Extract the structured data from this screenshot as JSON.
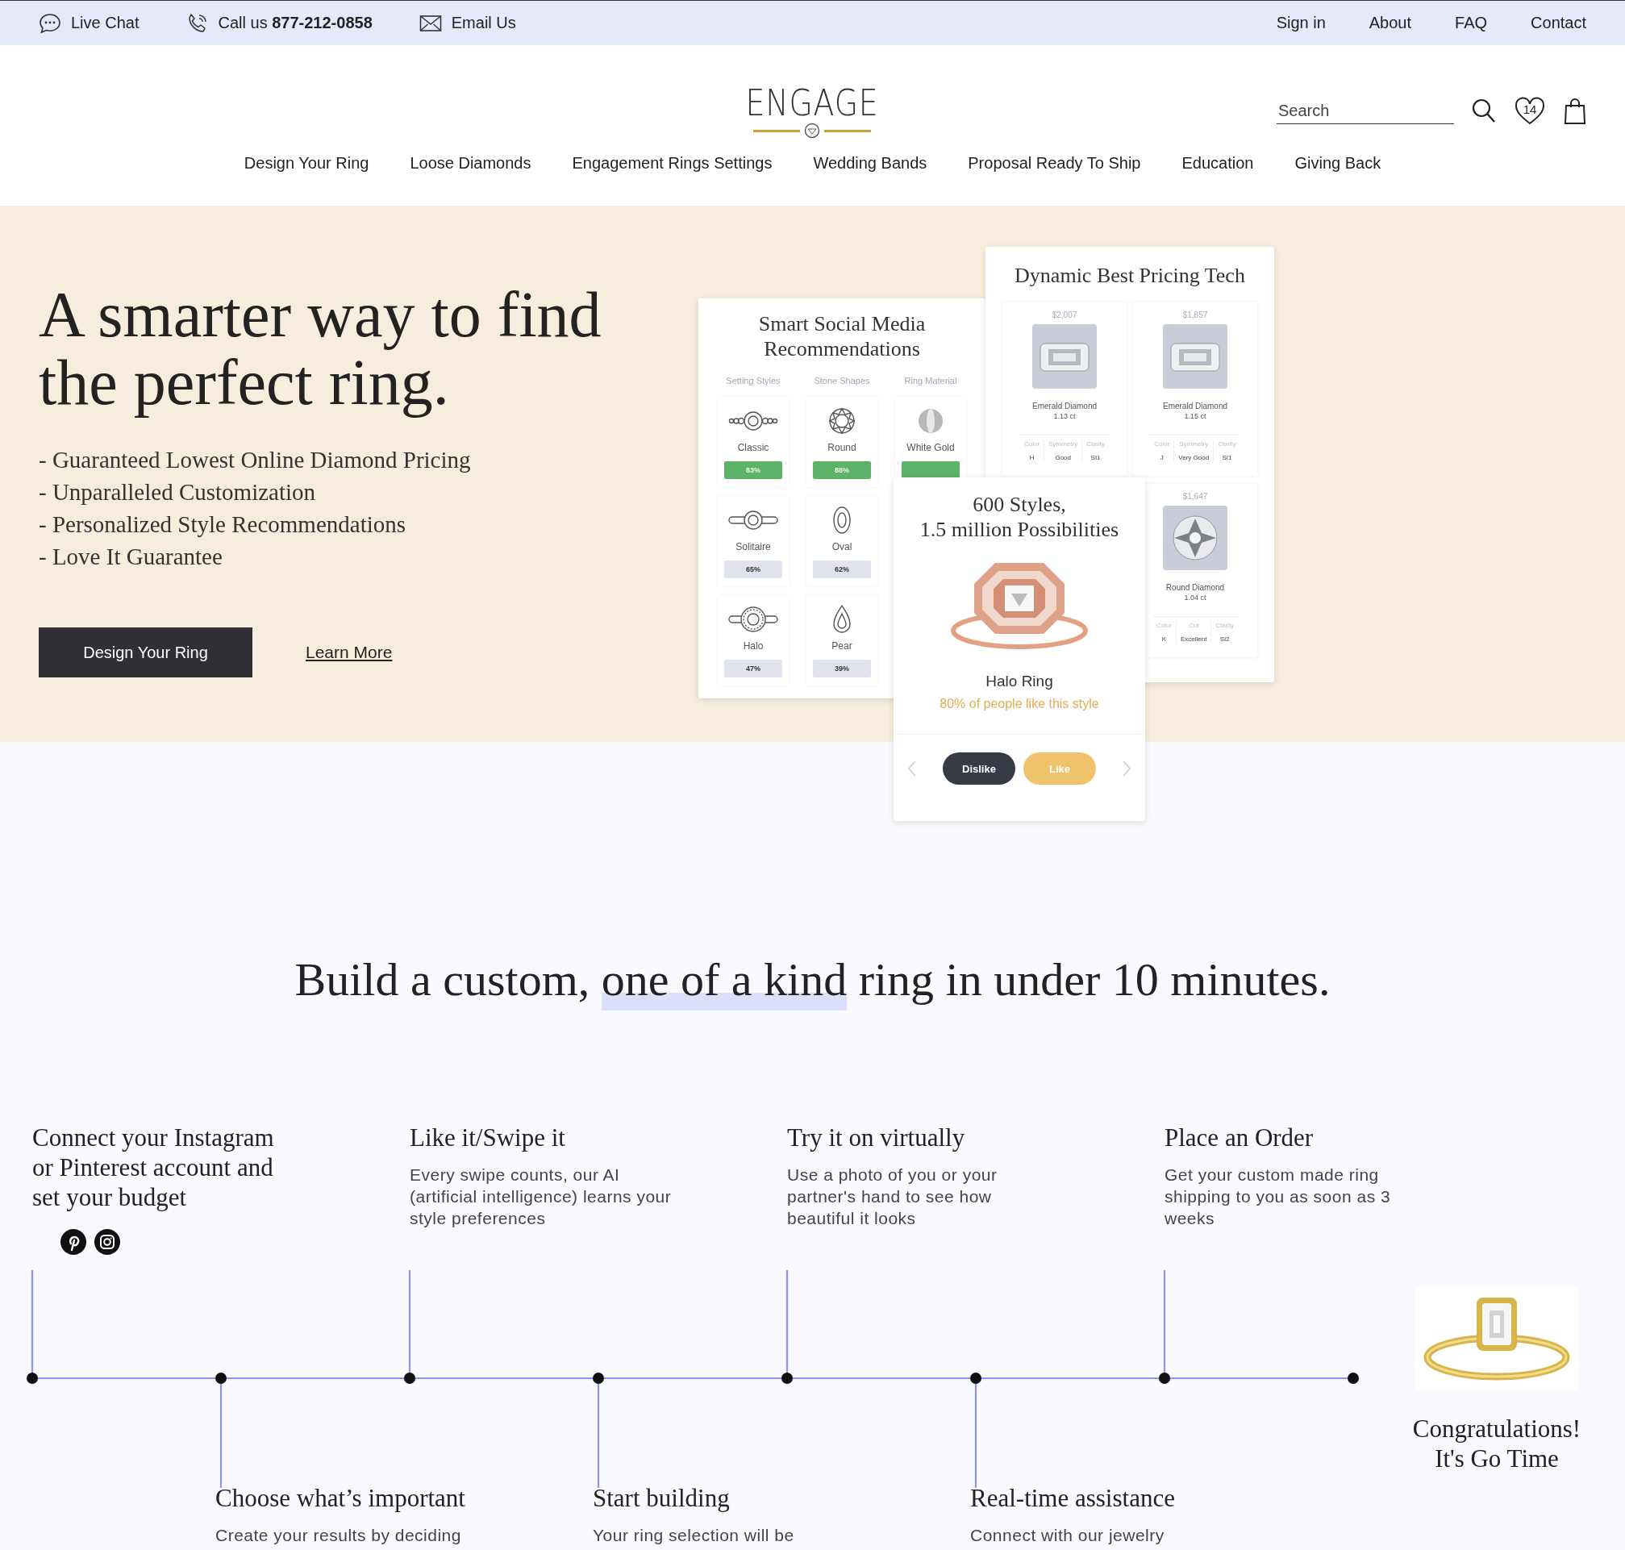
{
  "top_bar": {
    "contacts": [
      {
        "kind": "chat",
        "label": "Live Chat"
      },
      {
        "kind": "phone",
        "label": "Call us **877-212-0858**"
      },
      {
        "kind": "mail",
        "label": "Email Us"
      }
    ],
    "links": [
      "Sign in",
      "About",
      "FAQ",
      "Contact"
    ]
  },
  "header": {
    "logo": "ENGAGE",
    "search": {
      "placeholder": "Search"
    },
    "wishlist_count": "14",
    "nav": [
      "Design Your Ring",
      "Loose Diamonds",
      "Engagement Rings Settings",
      "Wedding Bands",
      "Proposal Ready To Ship",
      "Education",
      "Giving Back"
    ]
  },
  "hero": {
    "title": "A smarter way to find the perfect ring.",
    "bullets": [
      "- Guaranteed Lowest Online Diamond Pricing",
      "- Unparalleled Customization",
      "- Personalized Style Recommendations",
      "- Love It Guarantee"
    ],
    "primary_button": "Design Your Ring",
    "link": "Learn More",
    "social_card": {
      "title": "Smart Social Media Recommendations",
      "columns": [
        {
          "header": "Setting Styles",
          "tiles": [
            {
              "kind": "classic",
              "name": "Classic",
              "percent": "83%",
              "top_match": true
            },
            {
              "kind": "solitaire",
              "name": "Solitaire",
              "percent": "65%",
              "top_match": false
            },
            {
              "kind": "halo",
              "name": "Halo",
              "percent": "47%",
              "top_match": false
            }
          ]
        },
        {
          "header": "Stone Shapes",
          "tiles": [
            {
              "kind": "round",
              "name": "Round",
              "percent": "88%",
              "top_match": true
            },
            {
              "kind": "oval",
              "name": "Oval",
              "percent": "62%",
              "top_match": false
            },
            {
              "kind": "pear",
              "name": "Pear",
              "percent": "39%",
              "top_match": false
            }
          ]
        },
        {
          "header": "Ring Material",
          "tiles": [
            {
              "kind": "metal",
              "name": "White Gold",
              "top_match": true
            }
          ]
        }
      ]
    },
    "pricing_card": {
      "title": "Dynamic Best Pricing Tech",
      "columns": [
        [
          {
            "price": "$2,007",
            "kind": "emerald",
            "name": "Emerald Diamond",
            "carat": "1.13 ct",
            "specs": [
              {
                "label": "Color",
                "value": "H"
              },
              {
                "label": "Symmetry",
                "value": "Good"
              },
              {
                "label": "Clarity",
                "value": "SI1"
              }
            ]
          }
        ],
        [
          {
            "price": "$1,857",
            "kind": "emerald",
            "name": "Emerald Diamond",
            "carat": "1.15 ct",
            "specs": [
              {
                "label": "Color",
                "value": "J"
              },
              {
                "label": "Symmetry",
                "value": "Very Good"
              },
              {
                "label": "Clarity",
                "value": "SI1"
              }
            ]
          },
          {
            "price": "$1,647",
            "kind": "round",
            "name": "Round Diamond",
            "carat": "1.04 ct",
            "specs": [
              {
                "label": "Color",
                "value": "K"
              },
              {
                "label": "Cut",
                "value": "Excellent"
              },
              {
                "label": "Clarity",
                "value": "SI2"
              }
            ]
          }
        ]
      ]
    },
    "style_card": {
      "title_lines": [
        "600 Styles,",
        "1.5 million Possibilities"
      ],
      "name": "Halo Ring",
      "note": "80% of people like this style",
      "buttons": [
        "Dislike",
        "Like"
      ]
    }
  },
  "how_it_works": {
    "heading": {
      "before": "Build a custom, ",
      "highlight": "one of a kind",
      "after": " ring in under 10 minutes."
    },
    "top_steps": [
      {
        "title": "Connect your Instagram or Pinterest account and set your budget",
        "social": true
      },
      {
        "title": "Like it/Swipe it",
        "text": "Every swipe counts, our AI (artificial intelligence) learns your style preferences"
      },
      {
        "title": "Try it on virtually",
        "text": "Use a photo of you or your partner's hand to see how beautiful it looks"
      },
      {
        "title": "Place an Order",
        "text": "Get your custom made ring shipping to you as soon as 3 weeks"
      }
    ],
    "bottom_steps": [
      {
        "title": "Choose what’s important",
        "text": "Create your results by deciding"
      },
      {
        "title": "Start building",
        "text": "Your ring selection will be"
      },
      {
        "title": "Real-time assistance",
        "text": "Connect with our jewelry"
      }
    ],
    "final": {
      "title_lines": [
        "Congratulations!",
        "It's Go Time"
      ]
    }
  }
}
